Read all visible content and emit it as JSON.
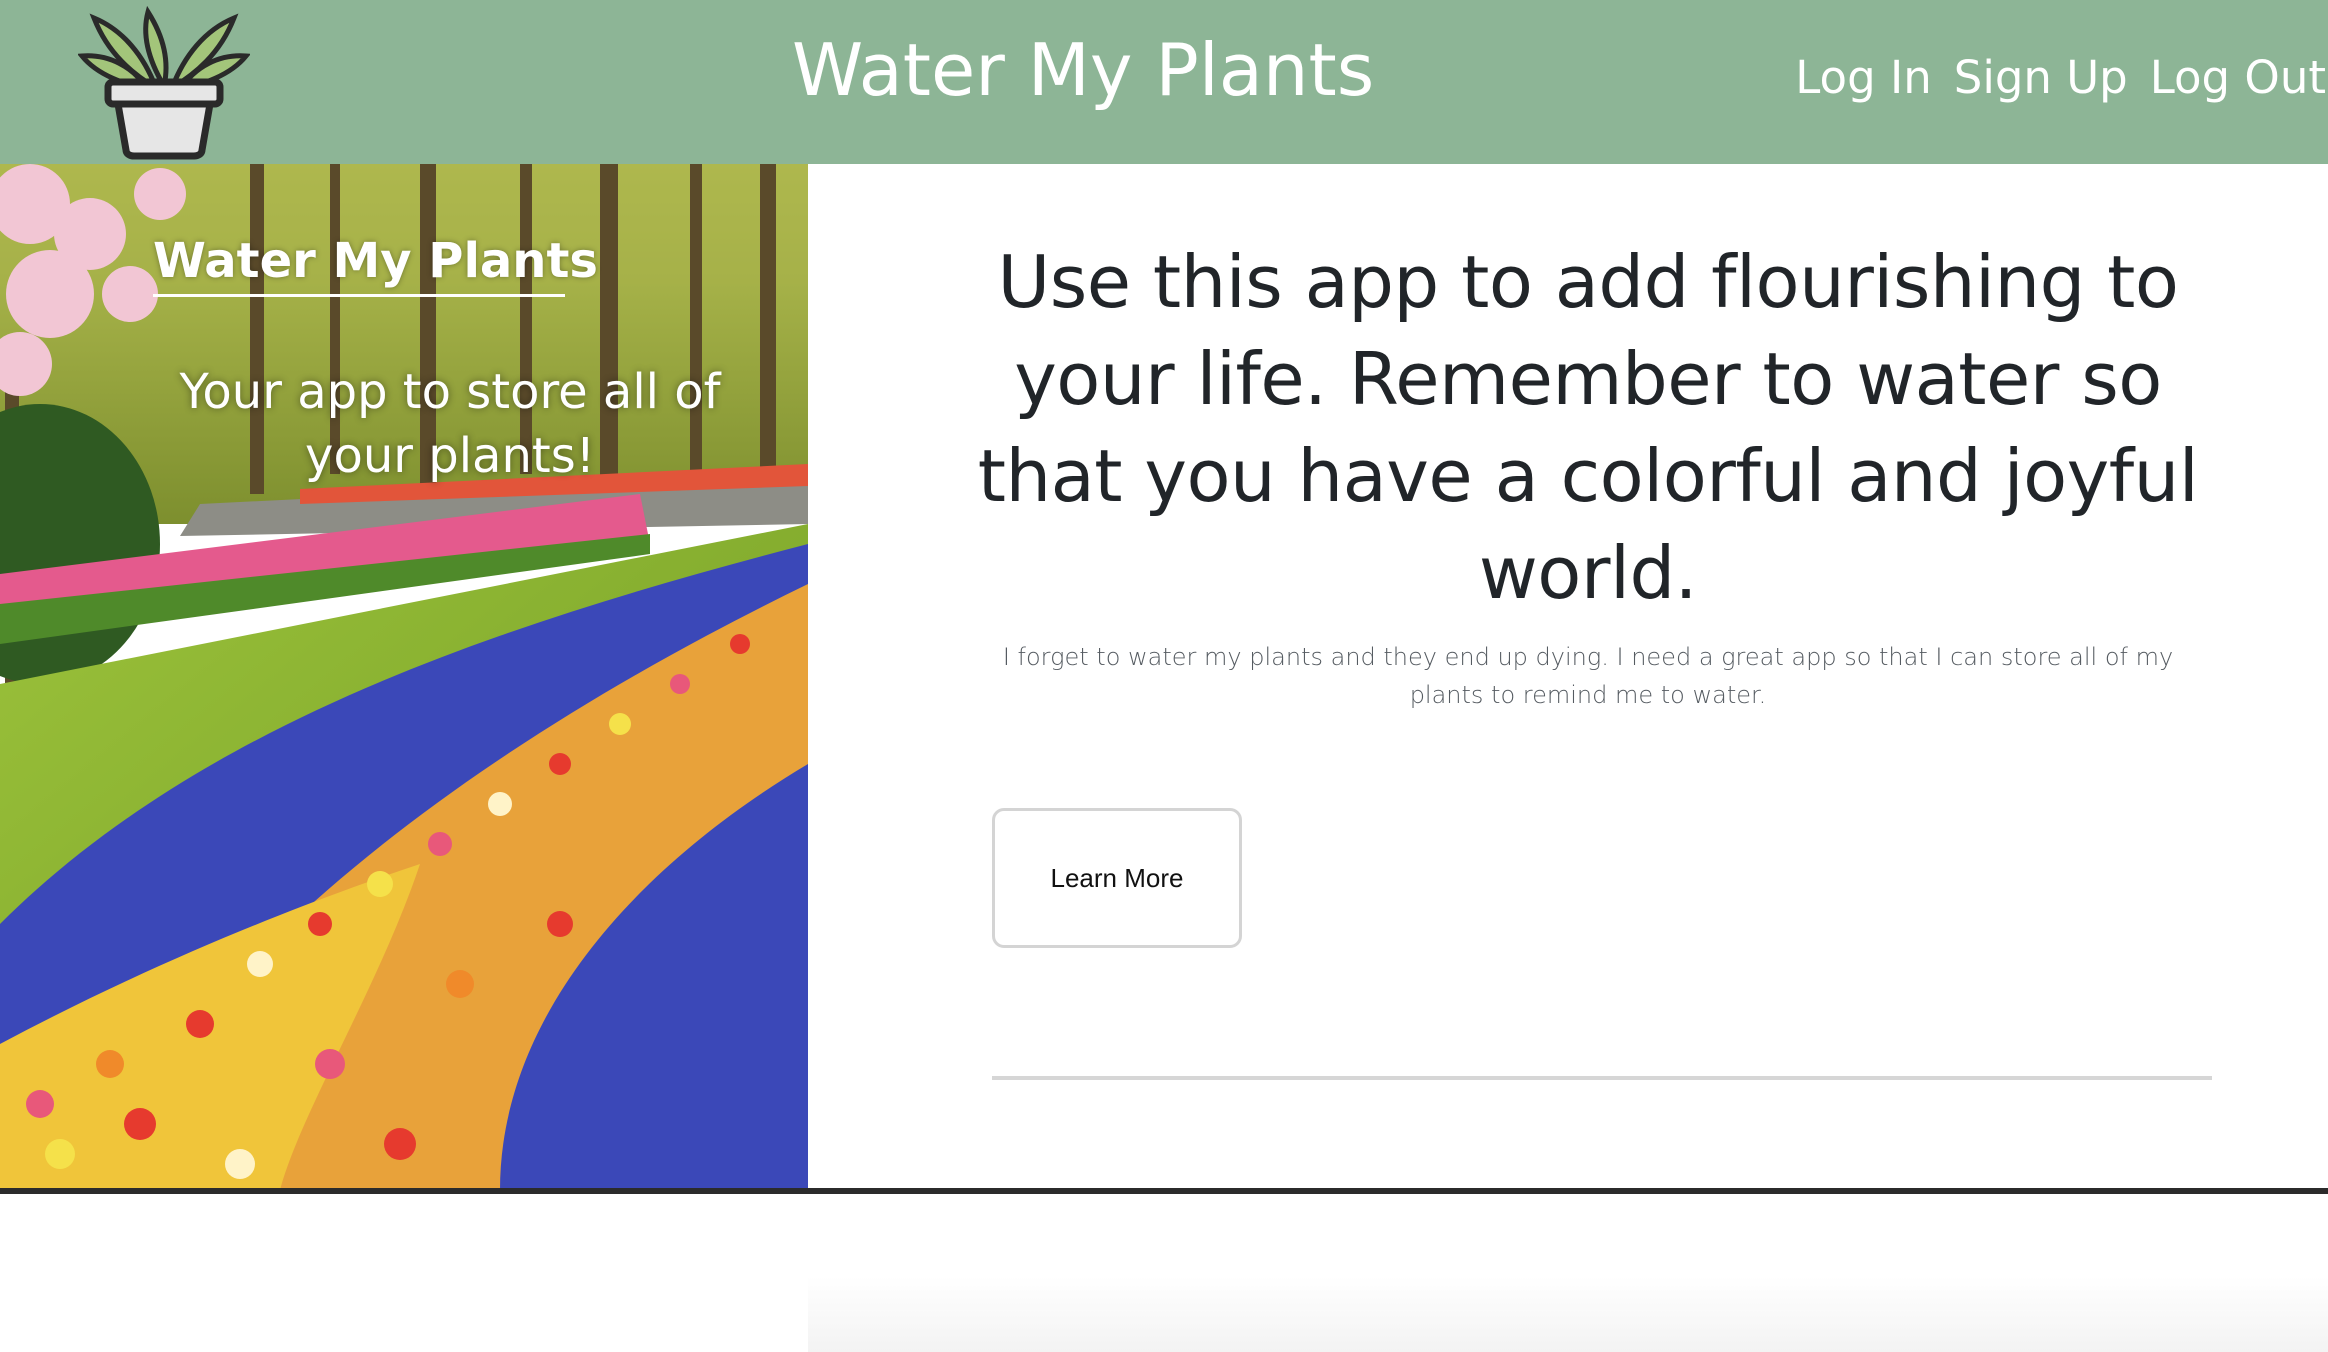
{
  "header": {
    "logo_icon": "potted-plant-icon",
    "site_title": "Water My Plants",
    "nav": {
      "login": "Log In",
      "signup": "Sign Up",
      "logout": "Log Out"
    },
    "bg_color": "#8db596"
  },
  "hero": {
    "image": "tulip-garden-photo",
    "title": "Water My Plants",
    "subtitle": "Your app to store all of your plants!"
  },
  "main": {
    "headline": "Use this app to add flourishing to your life. Remember to water so that you have a colorful and joyful world.",
    "lead": "I forget to water my plants and they end up dying. I need a great app so that I can store all of my plants to remind me to water.",
    "learn_more_label": "Learn More"
  }
}
